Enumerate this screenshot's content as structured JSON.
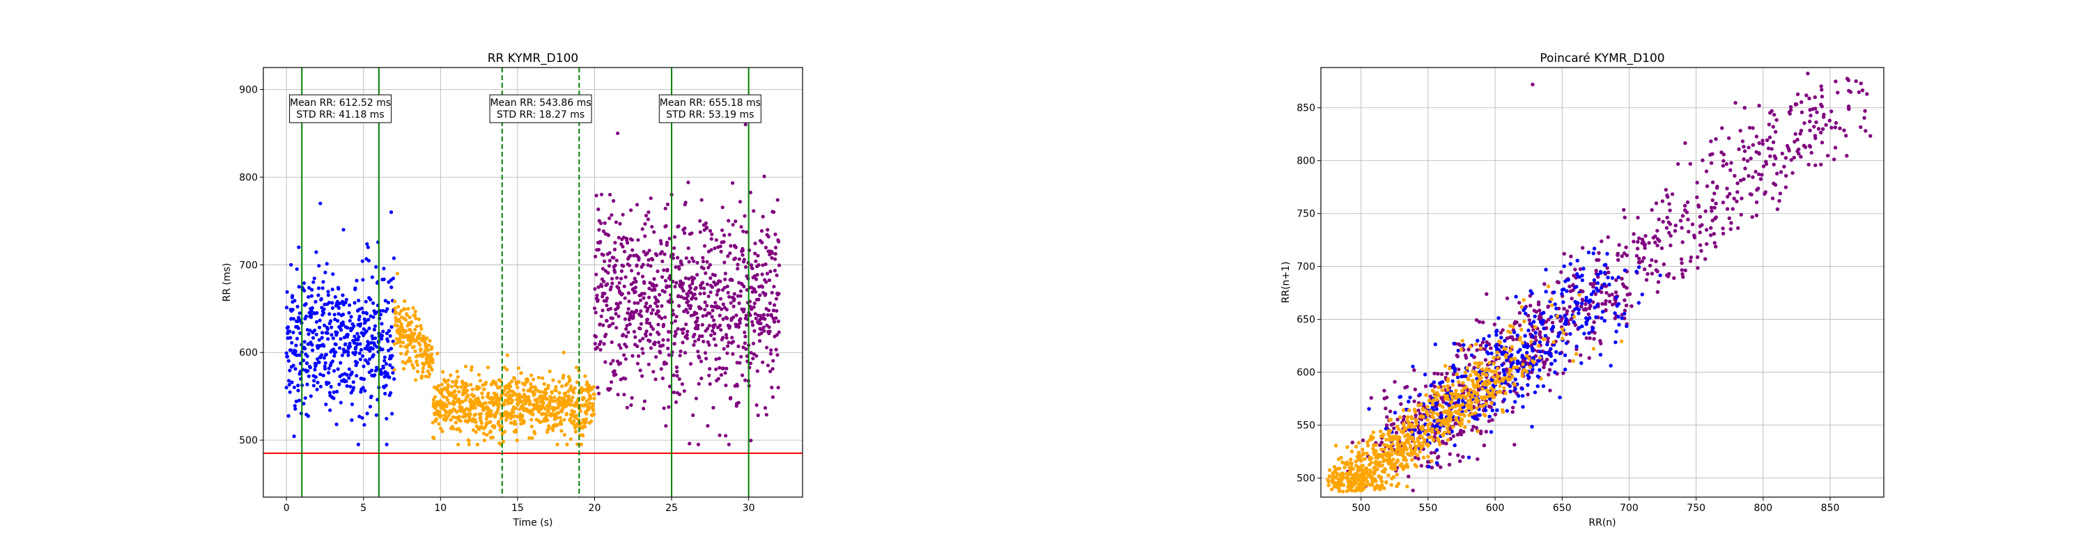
{
  "chart_data": [
    {
      "type": "scatter",
      "title": "RR KYMR_D100",
      "xlabel": "Time (s)",
      "ylabel": "RR (ms)",
      "xlim": [
        -1.5,
        33.5
      ],
      "ylim": [
        435,
        925
      ],
      "xticks": [
        0,
        5,
        10,
        15,
        20,
        25,
        30
      ],
      "yticks": [
        500,
        600,
        700,
        800,
        900
      ],
      "grid": true,
      "colors": {
        "blue": "#0000ff",
        "orange": "#ffa500",
        "purple": "#800080",
        "green": "#008000",
        "red": "#ff0000"
      },
      "threshold_line": {
        "y": 485,
        "color": "#ff0000"
      },
      "vlines": [
        {
          "x": 1,
          "style": "solid",
          "color": "#008000"
        },
        {
          "x": 6,
          "style": "solid",
          "color": "#008000"
        },
        {
          "x": 14,
          "style": "dashed",
          "color": "#008000"
        },
        {
          "x": 19,
          "style": "dashed",
          "color": "#008000"
        },
        {
          "x": 25,
          "style": "solid",
          "color": "#008000"
        },
        {
          "x": 30,
          "style": "solid",
          "color": "#008000"
        }
      ],
      "annotations": [
        {
          "x": 3.5,
          "y": 878,
          "lines": [
            "Mean RR: 612.52 ms",
            "STD RR: 41.18 ms"
          ]
        },
        {
          "x": 16.5,
          "y": 878,
          "lines": [
            "Mean RR: 543.86 ms",
            "STD RR: 18.27 ms"
          ]
        },
        {
          "x": 27.5,
          "y": 878,
          "lines": [
            "Mean RR: 655.18 ms",
            "STD RR: 53.19 ms"
          ]
        }
      ],
      "series": [
        {
          "color": "#0000ff",
          "x_range": [
            0,
            7
          ],
          "mean": 612,
          "std": 41,
          "samples": [
            [
              0.0,
              560
            ],
            [
              0.3,
              700
            ],
            [
              0.8,
              720
            ],
            [
              1.5,
              610
            ],
            [
              2.2,
              770
            ],
            [
              3.0,
              590
            ],
            [
              3.7,
              740
            ],
            [
              4.5,
              600
            ],
            [
              5.3,
              720
            ],
            [
              6.0,
              560
            ],
            [
              6.8,
              760
            ]
          ]
        },
        {
          "color": "#ffa500",
          "x_range": [
            7,
            20
          ],
          "mean": 544,
          "std": 18,
          "samples": [
            [
              7.2,
              690
            ],
            [
              8.0,
              640
            ],
            [
              9.0,
              600
            ],
            [
              10.0,
              540
            ],
            [
              11.0,
              520
            ],
            [
              12.0,
              580
            ],
            [
              13.0,
              530
            ],
            [
              15.0,
              560
            ],
            [
              17.0,
              540
            ],
            [
              18.0,
              600
            ],
            [
              19.5,
              540
            ]
          ]
        },
        {
          "color": "#800080",
          "x_range": [
            20,
            32
          ],
          "mean": 655,
          "std": 53,
          "samples": [
            [
              20.2,
              560
            ],
            [
              21.0,
              780
            ],
            [
              21.5,
              850
            ],
            [
              22.5,
              640
            ],
            [
              23.5,
              760
            ],
            [
              25.0,
              780
            ],
            [
              26.0,
              620
            ],
            [
              27.5,
              700
            ],
            [
              29.0,
              640
            ],
            [
              29.8,
              860
            ],
            [
              30.5,
              875
            ],
            [
              31.5,
              560
            ]
          ]
        }
      ]
    },
    {
      "type": "scatter",
      "title": "Poincaré KYMR_D100",
      "xlabel": "RR(n)",
      "ylabel": "RR(n+1)",
      "xlim": [
        470,
        890
      ],
      "ylim": [
        482,
        888
      ],
      "xticks": [
        500,
        550,
        600,
        650,
        700,
        750,
        800,
        850
      ],
      "yticks": [
        500,
        550,
        600,
        650,
        700,
        750,
        800,
        850
      ],
      "grid": true,
      "series": [
        {
          "color": "#ffa500",
          "range": [
            485,
            640
          ],
          "note": "orange cluster"
        },
        {
          "color": "#0000ff",
          "range": [
            530,
            700
          ],
          "note": "blue cluster"
        },
        {
          "color": "#800080",
          "range": [
            530,
            875
          ],
          "note": "purple cluster"
        }
      ],
      "outliers": [
        [
          628,
          872
        ],
        [
          873,
          873
        ],
        [
          876,
          847
        ],
        [
          797,
          852
        ],
        [
          835,
          848
        ]
      ]
    }
  ]
}
